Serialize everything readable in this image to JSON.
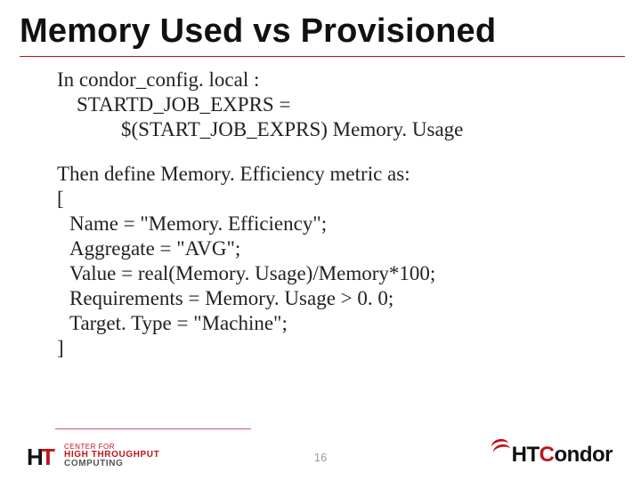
{
  "title": "Memory Used vs Provisioned",
  "body": {
    "intro": "In condor_config. local :",
    "conf1": "STARTD_JOB_EXPRS =",
    "conf2": "$(START_JOB_EXPRS) Memory. Usage",
    "then": "Then define Memory. Efficiency metric as:",
    "open": "[",
    "defs": [
      "Name   = \"Memory. Efficiency\";",
      "Aggregate = \"AVG\";",
      "Value  = real(Memory. Usage)/Memory*100;",
      "Requirements = Memory. Usage > 0. 0;",
      "Target. Type = \"Machine\";"
    ],
    "close": "]"
  },
  "footer": {
    "page": "16",
    "left": {
      "line1": "CENTER FOR",
      "line2": "HIGH THROUGHPUT",
      "line3": "COMPUTING"
    },
    "right": {
      "ht": "HT",
      "c": "C",
      "ondor": "ondor"
    }
  }
}
